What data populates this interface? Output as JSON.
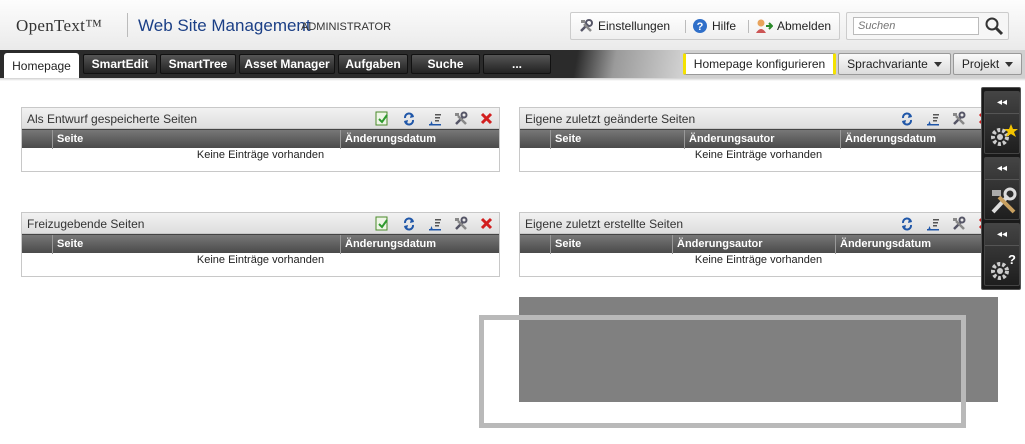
{
  "header": {
    "logo": "OpenText™",
    "product": "Web Site Management",
    "role": "ADMINISTRATOR",
    "menu": {
      "settings": "Einstellungen",
      "help": "Hilfe",
      "logout": "Abmelden"
    },
    "search": {
      "placeholder": "Suchen"
    }
  },
  "tabs": [
    {
      "label": "Homepage"
    },
    {
      "label": "SmartEdit"
    },
    {
      "label": "SmartTree"
    },
    {
      "label": "Asset Manager"
    },
    {
      "label": "Aufgaben"
    },
    {
      "label": "Suche"
    },
    {
      "label": "..."
    }
  ],
  "right_tabs": {
    "configure": "Homepage konfigurieren",
    "language": "Sprachvariante",
    "project": "Projekt"
  },
  "panels": {
    "drafts": {
      "title": "Als Entwurf gespeicherte Seiten",
      "columns": [
        "Seite",
        "Änderungsdatum"
      ],
      "empty": "Keine Einträge vorhanden"
    },
    "changed": {
      "title": "Eigene zuletzt geänderte Seiten",
      "columns": [
        "Seite",
        "Änderungsautor",
        "Änderungsdatum"
      ],
      "empty": "Keine Einträge vorhanden"
    },
    "release": {
      "title": "Freizugebende Seiten",
      "columns": [
        "Seite",
        "Änderungsdatum"
      ],
      "empty": "Keine Einträge vorhanden"
    },
    "created": {
      "title": "Eigene zuletzt erstellte Seiten",
      "columns": [
        "Seite",
        "Änderungsautor",
        "Änderungsdatum"
      ],
      "empty": "Keine Einträge vorhanden"
    }
  },
  "sidebar": {
    "collapse": "◂◂"
  },
  "colors": {
    "accent_yellow": "#f4e200",
    "product_blue": "#1b3f86",
    "delete_red": "#d21f1f"
  }
}
